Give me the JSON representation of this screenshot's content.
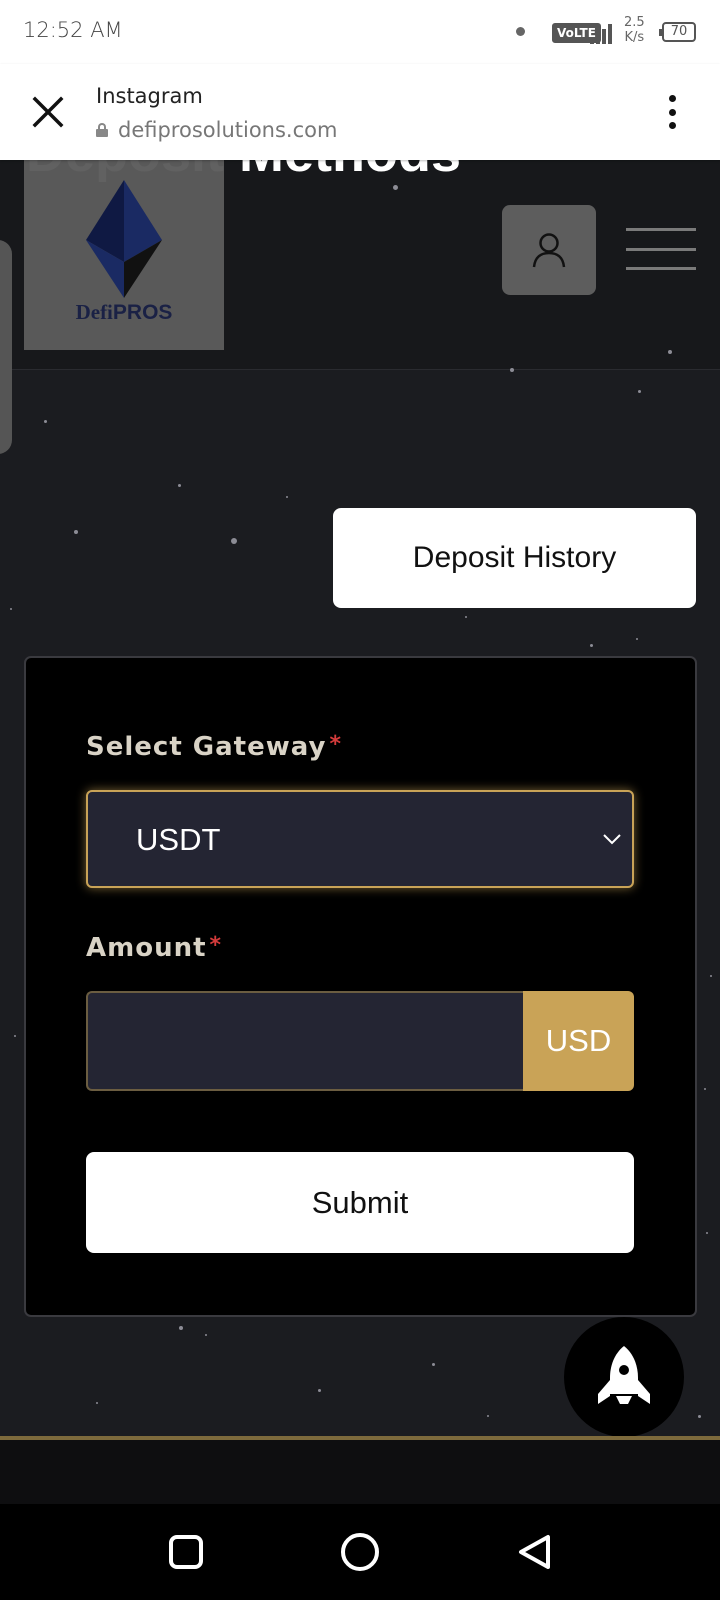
{
  "status_bar": {
    "time": "12:52 AM",
    "volte": "VoLTE",
    "speed_value": "2.5",
    "speed_unit": "K/s",
    "battery": "70"
  },
  "browser": {
    "title": "Instagram",
    "url": "defiprosolutions.com"
  },
  "header": {
    "page_heading": "Deposit Methods",
    "logo_defi": "Defi",
    "logo_pros": "PROS"
  },
  "actions": {
    "deposit_history": "Deposit History"
  },
  "form": {
    "gateway_label": "Select Gateway",
    "gateway_required": "*",
    "gateway_value": "USDT",
    "amount_label": "Amount",
    "amount_required": "*",
    "amount_value": "",
    "currency": "USD",
    "submit": "Submit"
  },
  "colors": {
    "accent_gold": "#c9a357",
    "card_bg": "#000000",
    "page_bg": "#1b1c20",
    "required": "#d43b3b"
  },
  "icons": {
    "close": "close-icon",
    "lock": "lock-icon",
    "more": "more-vertical-icon",
    "user": "user-icon",
    "menu": "hamburger-icon",
    "chevron": "chevron-down-icon",
    "rocket": "rocket-icon",
    "nav_recents": "square-icon",
    "nav_home": "circle-icon",
    "nav_back": "triangle-back-icon"
  }
}
